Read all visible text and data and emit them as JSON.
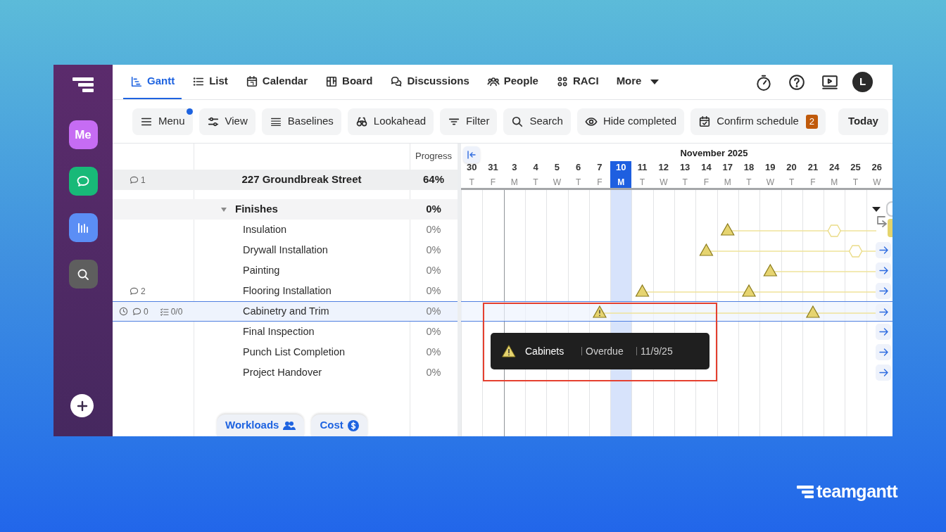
{
  "sidebar": {
    "me_label": "Me"
  },
  "tabs": [
    {
      "label": "Gantt",
      "kind": "gantt",
      "selected": true
    },
    {
      "label": "List",
      "kind": "list",
      "selected": false
    },
    {
      "label": "Calendar",
      "kind": "calendar",
      "selected": false
    },
    {
      "label": "Board",
      "kind": "board",
      "selected": false
    },
    {
      "label": "Discussions",
      "kind": "discussions",
      "selected": false
    },
    {
      "label": "People",
      "kind": "people",
      "selected": false
    },
    {
      "label": "RACI",
      "kind": "raci",
      "selected": false
    },
    {
      "label": "More",
      "kind": "more",
      "selected": false
    }
  ],
  "user_avatar": "L",
  "toolbar": [
    {
      "label": "Menu",
      "kind": "menu",
      "notification": true
    },
    {
      "label": "View",
      "kind": "view",
      "notification": false
    },
    {
      "label": "Baselines",
      "kind": "baselines",
      "notification": false
    },
    {
      "label": "Lookahead",
      "kind": "lookahead",
      "notification": false
    },
    {
      "label": "Filter",
      "kind": "filter",
      "notification": false
    },
    {
      "label": "Search",
      "kind": "search",
      "notification": false
    },
    {
      "label": "Hide completed",
      "kind": "hide",
      "notification": false
    },
    {
      "label": "Confirm schedule",
      "kind": "confirm",
      "notification": false,
      "badge": "2"
    },
    {
      "label": "Today",
      "kind": "today",
      "notification": false
    }
  ],
  "progress_header": "Progress",
  "project": {
    "comments": "1",
    "name": "227 Groundbreak Street",
    "progress": "64%"
  },
  "group": {
    "name": "Finishes",
    "progress": "0%",
    "expanded": true
  },
  "tasks": [
    {
      "name": "Insulation",
      "progress": "0%",
      "selected": false
    },
    {
      "name": "Drywall Installation",
      "progress": "0%",
      "selected": false
    },
    {
      "name": "Painting",
      "progress": "0%",
      "selected": false
    },
    {
      "name": "Flooring Installation",
      "progress": "0%",
      "selected": false,
      "comments": "2"
    },
    {
      "name": "Cabinetry and Trim",
      "progress": "0%",
      "selected": true,
      "comments": "0",
      "checklist": "0/0"
    },
    {
      "name": "Final Inspection",
      "progress": "0%",
      "selected": false
    },
    {
      "name": "Punch List Completion",
      "progress": "0%",
      "selected": false
    },
    {
      "name": "Project Handover",
      "progress": "0%",
      "selected": false
    }
  ],
  "timeline": {
    "month": "November 2025",
    "days": [
      {
        "number": "30",
        "weekday": "T",
        "selected": false
      },
      {
        "number": "31",
        "weekday": "F",
        "selected": false
      },
      {
        "number": "3",
        "weekday": "M",
        "selected": false
      },
      {
        "number": "4",
        "weekday": "T",
        "selected": false
      },
      {
        "number": "5",
        "weekday": "W",
        "selected": false
      },
      {
        "number": "6",
        "weekday": "T",
        "selected": false
      },
      {
        "number": "7",
        "weekday": "F",
        "selected": false
      },
      {
        "number": "10",
        "weekday": "M",
        "selected": true
      },
      {
        "number": "11",
        "weekday": "T",
        "selected": false
      },
      {
        "number": "12",
        "weekday": "W",
        "selected": false
      },
      {
        "number": "13",
        "weekday": "T",
        "selected": false
      },
      {
        "number": "14",
        "weekday": "F",
        "selected": false
      },
      {
        "number": "17",
        "weekday": "M",
        "selected": false
      },
      {
        "number": "18",
        "weekday": "T",
        "selected": false
      },
      {
        "number": "19",
        "weekday": "W",
        "selected": false
      },
      {
        "number": "20",
        "weekday": "T",
        "selected": false
      },
      {
        "number": "21",
        "weekday": "F",
        "selected": false
      },
      {
        "number": "24",
        "weekday": "M",
        "selected": false
      },
      {
        "number": "25",
        "weekday": "T",
        "selected": false
      },
      {
        "number": "26",
        "weekday": "W",
        "selected": false
      }
    ]
  },
  "tooltip": {
    "task": "Cabinets",
    "status": "Overdue",
    "date": "11/9/25"
  },
  "bottom_tabs": [
    {
      "label": "Workloads",
      "kind": "workloads"
    },
    {
      "label": "Cost",
      "kind": "cost"
    }
  ],
  "brand": "teamgantt"
}
